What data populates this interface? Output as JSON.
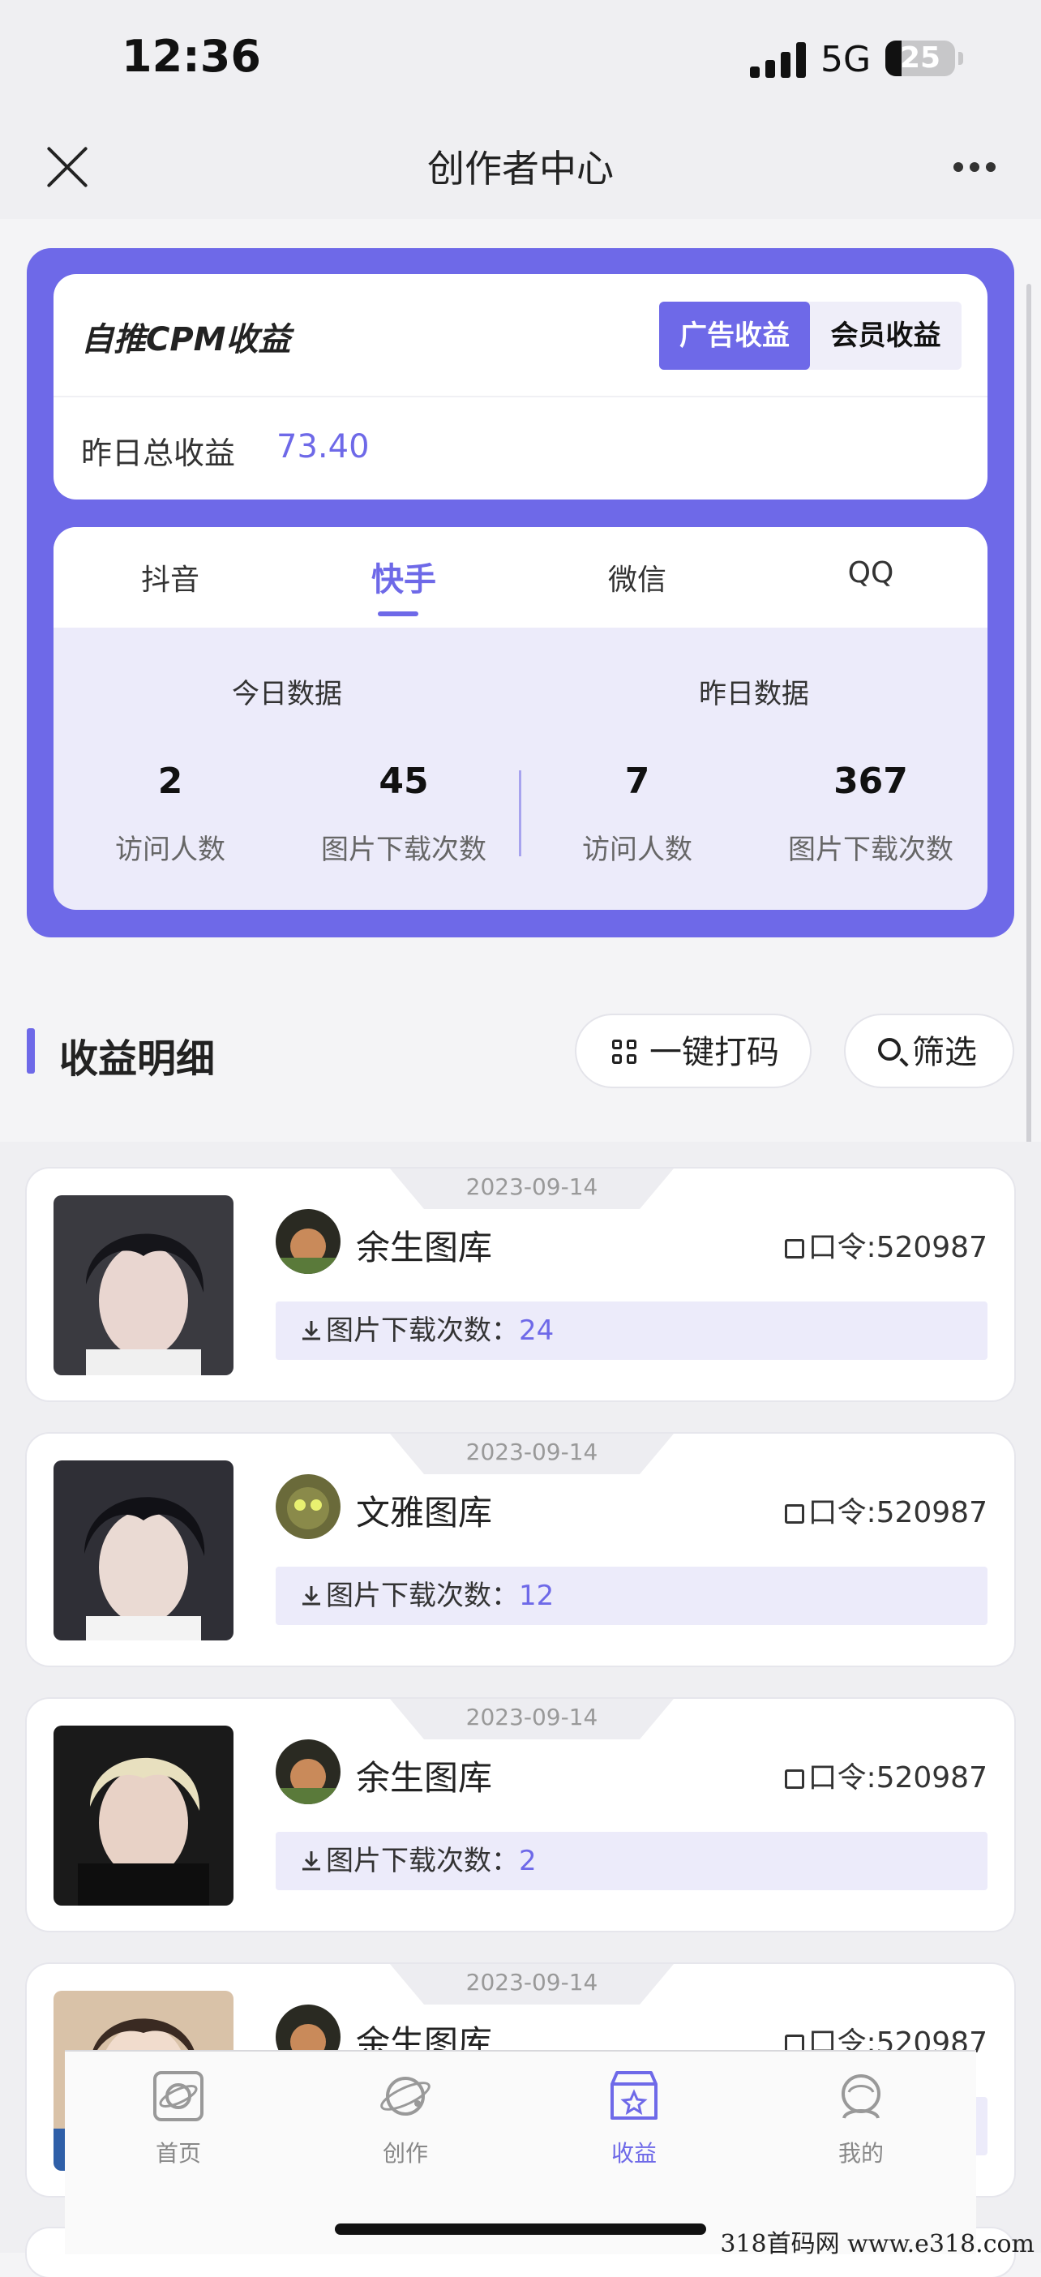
{
  "status_bar": {
    "time": "12:36",
    "network": "5G",
    "battery": "25"
  },
  "header": {
    "title": "创作者中心"
  },
  "cpm": {
    "title": "自推CPM收益",
    "tab_ad": "广告收益",
    "tab_vip": "会员收益",
    "yesterday_label": "昨日总收益",
    "yesterday_value": "73.40"
  },
  "platforms": [
    "抖音",
    "快手",
    "微信",
    "QQ"
  ],
  "active_platform": "快手",
  "stats": {
    "today_title": "今日数据",
    "yesterday_title": "昨日数据",
    "today": {
      "visitors": "2",
      "downloads": "45"
    },
    "yesterday": {
      "visitors": "7",
      "downloads": "367"
    },
    "visitors_label": "访问人数",
    "downloads_label": "图片下载次数"
  },
  "details": {
    "title": "收益明细",
    "code_button": "一键打码",
    "filter_button": "筛选"
  },
  "items": [
    {
      "date": "2023-09-14",
      "author": "余生图库",
      "code": "口令:520987",
      "dl_label": "图片下载次数：",
      "dl_value": "24"
    },
    {
      "date": "2023-09-14",
      "author": "文雅图库",
      "code": "口令:520987",
      "dl_label": "图片下载次数：",
      "dl_value": "12"
    },
    {
      "date": "2023-09-14",
      "author": "余生图库",
      "code": "口令:520987",
      "dl_label": "图片下载次数：",
      "dl_value": "2"
    },
    {
      "date": "2023-09-14",
      "author": "余生图库",
      "code": "口令:520987"
    }
  ],
  "tabbar": {
    "home": "首页",
    "create": "创作",
    "earnings": "收益",
    "mine": "我的"
  },
  "watermark": "318首码网 www.e318.com",
  "colors": {
    "accent": "#6e69e8",
    "light_accent": "#ecebfa"
  }
}
